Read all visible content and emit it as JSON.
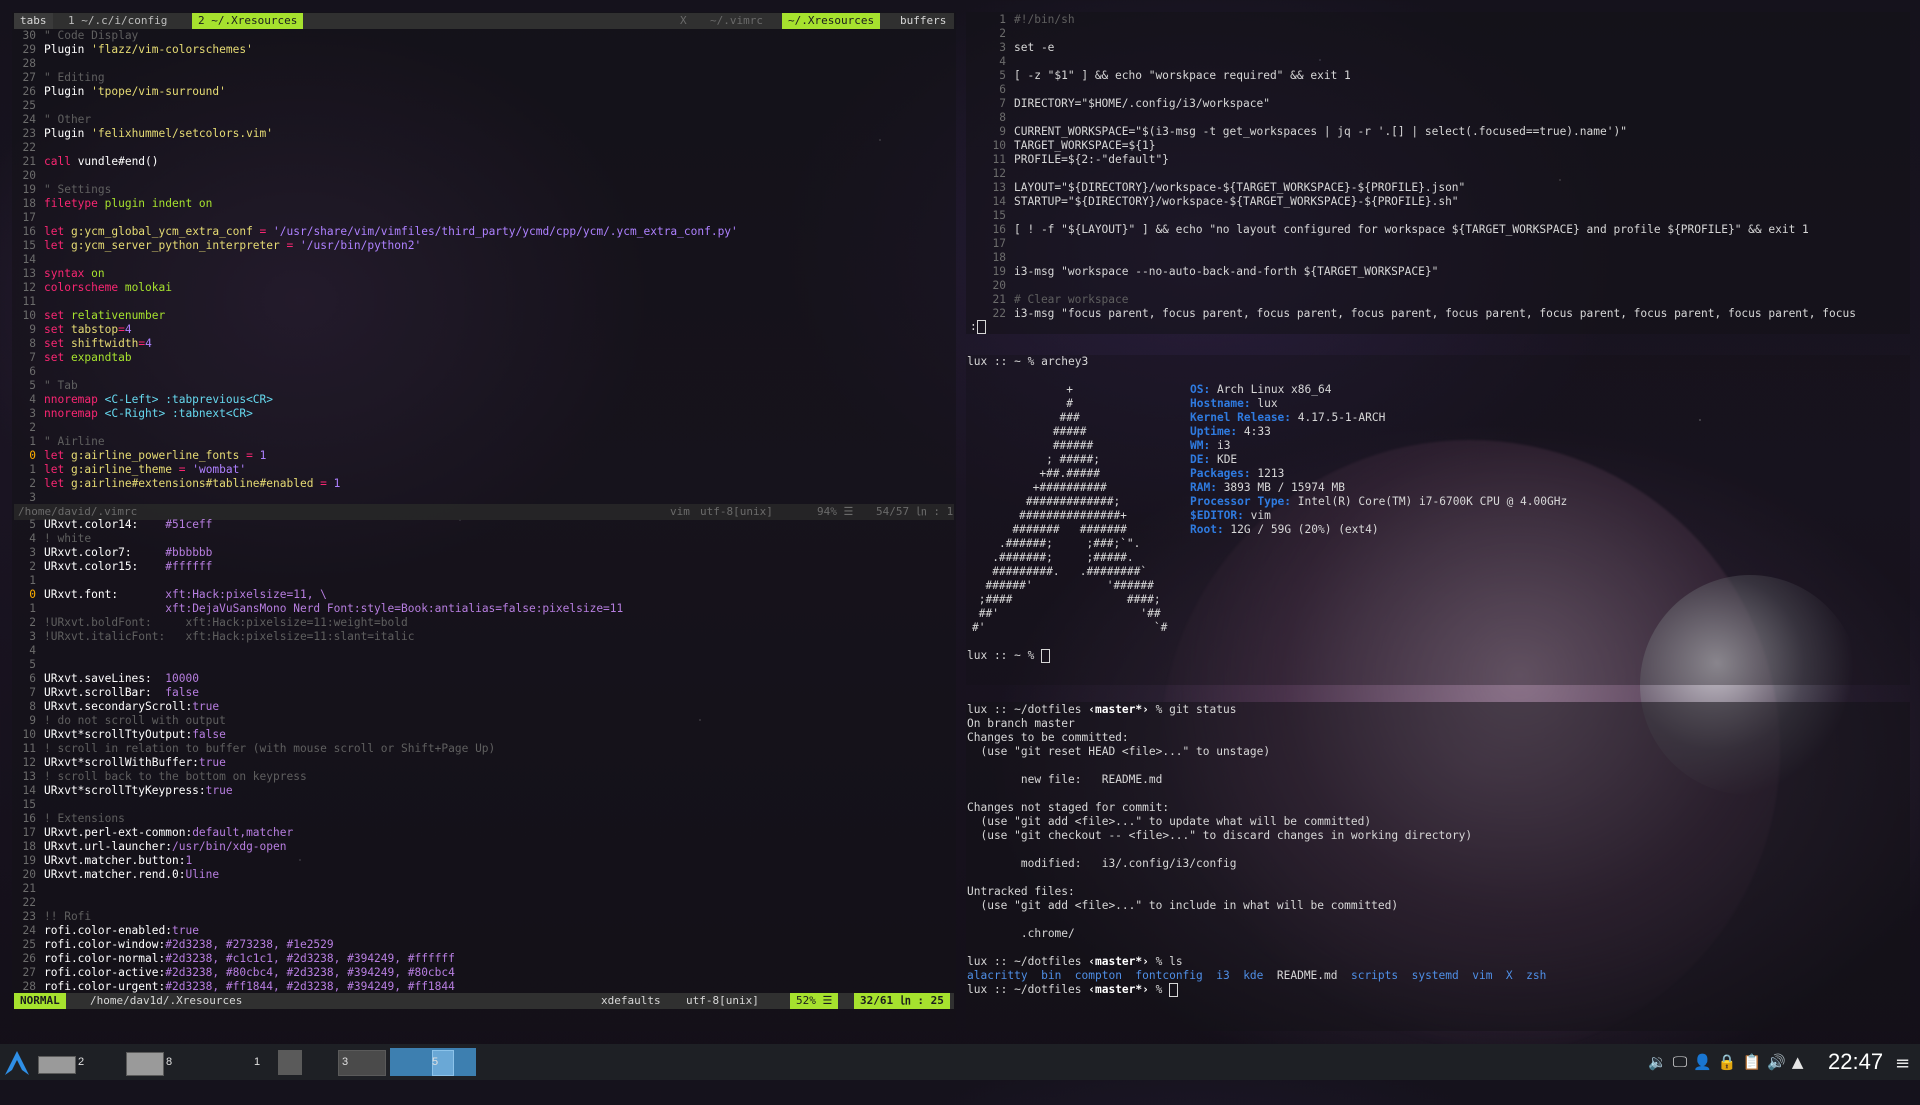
{
  "vim_tabs": {
    "label": "tabs",
    "tab1": "1 ~/.c/i/config",
    "tab2": "2 ~/.Xresources",
    "right_x": "X",
    "right_vimrc": "~/.vimrc",
    "right_xres": "~/.Xresources",
    "buffers": "buffers"
  },
  "vimrc_lines": [
    {
      "n": "30",
      "t": "\" Code Display",
      "c": "cm"
    },
    {
      "n": "29",
      "t": "Plugin 'flazz/vim-colorschemes'",
      "c": "plugin"
    },
    {
      "n": "28",
      "t": "",
      "c": ""
    },
    {
      "n": "27",
      "t": "\" Editing",
      "c": "cm"
    },
    {
      "n": "26",
      "t": "Plugin 'tpope/vim-surround'",
      "c": "plugin"
    },
    {
      "n": "25",
      "t": "",
      "c": ""
    },
    {
      "n": "24",
      "t": "\" Other",
      "c": "cm"
    },
    {
      "n": "23",
      "t": "Plugin 'felixhummel/setcolors.vim'",
      "c": "plugin"
    },
    {
      "n": "22",
      "t": "",
      "c": ""
    },
    {
      "n": "21",
      "t": "call vundle#end()",
      "c": "call"
    },
    {
      "n": "20",
      "t": "",
      "c": ""
    },
    {
      "n": "19",
      "t": "\" Settings",
      "c": "cm"
    },
    {
      "n": "18",
      "t": "filetype plugin indent on",
      "c": "kw"
    },
    {
      "n": "17",
      "t": "",
      "c": ""
    },
    {
      "n": "16",
      "t": "let g:ycm_global_ycm_extra_conf = '/usr/share/vim/vimfiles/third_party/ycmd/cpp/ycm/.ycm_extra_conf.py'",
      "c": "let"
    },
    {
      "n": "15",
      "t": "let g:ycm_server_python_interpreter = '/usr/bin/python2'",
      "c": "let"
    },
    {
      "n": "14",
      "t": "",
      "c": ""
    },
    {
      "n": "13",
      "t": "syntax on",
      "c": "kw"
    },
    {
      "n": "12",
      "t": "colorscheme molokai",
      "c": "kw"
    },
    {
      "n": "11",
      "t": "",
      "c": ""
    },
    {
      "n": "10",
      "t": "set relativenumber",
      "c": "set"
    },
    {
      "n": "9",
      "t": "set tabstop=4",
      "c": "set"
    },
    {
      "n": "8",
      "t": "set shiftwidth=4",
      "c": "set"
    },
    {
      "n": "7",
      "t": "set expandtab",
      "c": "set"
    },
    {
      "n": "6",
      "t": "",
      "c": ""
    },
    {
      "n": "5",
      "t": "\" Tab",
      "c": "cm"
    },
    {
      "n": "4",
      "t": "nnoremap <C-Left> :tabprevious<CR>",
      "c": "map"
    },
    {
      "n": "3",
      "t": "nnoremap <C-Right> :tabnext<CR>",
      "c": "map"
    },
    {
      "n": "2",
      "t": "",
      "c": ""
    },
    {
      "n": "1",
      "t": "\" Airline",
      "c": "cm"
    },
    {
      "n": "0",
      "t": "let g:airline_powerline_fonts = 1",
      "c": "let",
      "cur": true
    },
    {
      "n": "1",
      "t": "let g:airline_theme = 'wombat'",
      "c": "let"
    },
    {
      "n": "2",
      "t": "let g:airline#extensions#tabline#enabled = 1",
      "c": "let"
    },
    {
      "n": "3",
      "t": "",
      "c": ""
    }
  ],
  "vimrc_status": {
    "path": "/home/david/.vimrc",
    "ft": "vim",
    "enc": "utf-8[unix]",
    "pct": "94% ☰",
    "pos": "54/57 ㏑ : 1"
  },
  "xres_lines": [
    {
      "n": "5",
      "k": "URxvt.color14:",
      "v": "#51ceff"
    },
    {
      "n": "4",
      "cm": "! white"
    },
    {
      "n": "3",
      "k": "URxvt.color7:",
      "v": "#bbbbbb"
    },
    {
      "n": "2",
      "k": "URxvt.color15:",
      "v": "#ffffff"
    },
    {
      "n": "1",
      "k": "",
      "v": ""
    },
    {
      "n": "0",
      "k": "URxvt.font:",
      "v": "xft:Hack:pixelsize=11, \\",
      "cur": true
    },
    {
      "n": "1",
      "k": "",
      "v": "xft:DejaVuSansMono Nerd Font:style=Book:antialias=false:pixelsize=11"
    },
    {
      "n": "2",
      "cm": "!URxvt.boldFont:     xft:Hack:pixelsize=11:weight=bold"
    },
    {
      "n": "3",
      "cm": "!URxvt.italicFont:   xft:Hack:pixelsize=11:slant=italic"
    },
    {
      "n": "4",
      "k": "",
      "v": ""
    },
    {
      "n": "5",
      "k": "",
      "v": ""
    },
    {
      "n": "6",
      "k": "URxvt.saveLines:",
      "v": "10000"
    },
    {
      "n": "7",
      "k": "URxvt.scrollBar:",
      "v": "false"
    },
    {
      "n": "8",
      "k": "URxvt.secondaryScroll:",
      "v": "true"
    },
    {
      "n": "9",
      "cm": "! do not scroll with output"
    },
    {
      "n": "10",
      "k": "URxvt*scrollTtyOutput:",
      "v": "false"
    },
    {
      "n": "11",
      "cm": "! scroll in relation to buffer (with mouse scroll or Shift+Page Up)"
    },
    {
      "n": "12",
      "k": "URxvt*scrollWithBuffer:",
      "v": "true"
    },
    {
      "n": "13",
      "cm": "! scroll back to the bottom on keypress"
    },
    {
      "n": "14",
      "k": "URxvt*scrollTtyKeypress:",
      "v": "true"
    },
    {
      "n": "15",
      "k": "",
      "v": ""
    },
    {
      "n": "16",
      "cm": "! Extensions"
    },
    {
      "n": "17",
      "k": "URxvt.perl-ext-common:",
      "v": "default,matcher"
    },
    {
      "n": "18",
      "k": "URxvt.url-launcher:",
      "v": "/usr/bin/xdg-open"
    },
    {
      "n": "19",
      "k": "URxvt.matcher.button:",
      "v": "1"
    },
    {
      "n": "20",
      "k": "URxvt.matcher.rend.0:",
      "v": "Uline"
    },
    {
      "n": "21",
      "k": "",
      "v": ""
    },
    {
      "n": "22",
      "k": "",
      "v": ""
    },
    {
      "n": "23",
      "cm": "!! Rofi"
    },
    {
      "n": "24",
      "k": "rofi.color-enabled:",
      "v": "true"
    },
    {
      "n": "25",
      "k": "rofi.color-window:",
      "v": "#2d3238, #273238, #1e2529"
    },
    {
      "n": "26",
      "k": "rofi.color-normal:",
      "v": "#2d3238, #c1c1c1, #2d3238, #394249, #ffffff"
    },
    {
      "n": "27",
      "k": "rofi.color-active:",
      "v": "#2d3238, #80cbc4, #2d3238, #394249, #80cbc4"
    },
    {
      "n": "28",
      "k": "rofi.color-urgent:",
      "v": "#2d3238, #ff1844, #2d3238, #394249, #ff1844"
    }
  ],
  "xres_status": {
    "mode": "NORMAL",
    "path": "/home/dav1d/.Xresources",
    "ft": "xdefaults",
    "enc": "utf-8[unix]",
    "pct": "52% ☰",
    "pos": "32/61 ㏑ : 25"
  },
  "script_lines": [
    {
      "n": "1",
      "t": "#!/bin/sh",
      "c": "cm"
    },
    {
      "n": "2",
      "t": "",
      "c": ""
    },
    {
      "n": "3",
      "t": "set -e",
      "c": "plain"
    },
    {
      "n": "4",
      "t": "",
      "c": ""
    },
    {
      "n": "5",
      "t": "[ -z \"$1\" ] && echo \"worskpace required\" && exit 1",
      "c": "plain"
    },
    {
      "n": "6",
      "t": "",
      "c": ""
    },
    {
      "n": "7",
      "t": "DIRECTORY=\"$HOME/.config/i3/workspace\"",
      "c": "plain"
    },
    {
      "n": "8",
      "t": "",
      "c": ""
    },
    {
      "n": "9",
      "t": "CURRENT_WORKSPACE=\"$(i3-msg -t get_workspaces | jq -r '.[] | select(.focused==true).name')\"",
      "c": "plain"
    },
    {
      "n": "10",
      "t": "TARGET_WORKSPACE=${1}",
      "c": "plain"
    },
    {
      "n": "11",
      "t": "PROFILE=${2:-\"default\"}",
      "c": "plain"
    },
    {
      "n": "12",
      "t": "",
      "c": ""
    },
    {
      "n": "13",
      "t": "LAYOUT=\"${DIRECTORY}/workspace-${TARGET_WORKSPACE}-${PROFILE}.json\"",
      "c": "plain"
    },
    {
      "n": "14",
      "t": "STARTUP=\"${DIRECTORY}/workspace-${TARGET_WORKSPACE}-${PROFILE}.sh\"",
      "c": "plain"
    },
    {
      "n": "15",
      "t": "",
      "c": ""
    },
    {
      "n": "16",
      "t": "[ ! -f \"${LAYOUT}\" ] && echo \"no layout configured for workspace ${TARGET_WORKSPACE} and profile ${PROFILE}\" && exit 1",
      "c": "plain"
    },
    {
      "n": "17",
      "t": "",
      "c": ""
    },
    {
      "n": "18",
      "t": "",
      "c": ""
    },
    {
      "n": "19",
      "t": "i3-msg \"workspace --no-auto-back-and-forth ${TARGET_WORKSPACE}\"",
      "c": "plain"
    },
    {
      "n": "20",
      "t": "",
      "c": ""
    },
    {
      "n": "21",
      "t": "# Clear workspace",
      "c": "cm"
    },
    {
      "n": "22",
      "t": "i3-msg \"focus parent, focus parent, focus parent, focus parent, focus parent, focus parent, focus parent, focus parent, focus",
      "c": "plain"
    }
  ],
  "script_cmdline": ":",
  "archey": {
    "prompt": "lux :: ~ % archey3",
    "prompt2": "lux :: ~ % ",
    "logo": [
      "              +",
      "              #",
      "             ###",
      "            #####",
      "            ######",
      "           ; #####;",
      "          +##.#####",
      "         +##########",
      "        #############;",
      "       ###############+",
      "      #######   #######",
      "    .######;     ;###;`\".",
      "   .#######;     ;#####.",
      "   #########.   .########`",
      "  ######'           '######",
      " ;####                 ####;",
      " ##'                     '##",
      "#'                         `#"
    ],
    "info": [
      {
        "k": "OS:",
        "v": "Arch Linux x86_64"
      },
      {
        "k": "Hostname:",
        "v": "lux"
      },
      {
        "k": "Kernel Release:",
        "v": "4.17.5-1-ARCH"
      },
      {
        "k": "Uptime:",
        "v": "4:33"
      },
      {
        "k": "WM:",
        "v": "i3"
      },
      {
        "k": "DE:",
        "v": "KDE"
      },
      {
        "k": "Packages:",
        "v": "1213"
      },
      {
        "k": "RAM:",
        "v": "3893 MB",
        "v2": " / 15974 MB"
      },
      {
        "k": "Processor Type:",
        "v": "Intel(R) Core(TM) i7-6700K CPU @ 4.00GHz"
      },
      {
        "k": "$EDITOR:",
        "v": "vim"
      },
      {
        "k": "Root:",
        "v": "12G",
        "v2": " / 59G (20%) (ext4)"
      }
    ]
  },
  "git": {
    "prompt1_pre": "lux :: ~/dotfiles ",
    "prompt1_branch": "‹master*›",
    "prompt1_cmd": " % git status",
    "l1": "On branch master",
    "l2": "Changes to be committed:",
    "l3": "  (use \"git reset HEAD <file>...\" to unstage)",
    "l4_pre": "        new file:   ",
    "l4_file": "README.md",
    "l5": "Changes not staged for commit:",
    "l6": "  (use \"git add <file>...\" to update what will be committed)",
    "l7": "  (use \"git checkout -- <file>...\" to discard changes in working directory)",
    "l8_pre": "        modified:   ",
    "l8_file": "i3/.config/i3/config",
    "l9": "Untracked files:",
    "l10": "  (use \"git add <file>...\" to include in what will be committed)",
    "l11": "        .chrome/",
    "prompt2_cmd": " % ls",
    "ls": [
      "alacritty",
      "bin",
      "compton",
      "fontconfig",
      "i3",
      "kde",
      "README.md",
      "scripts",
      "systemd",
      "vim",
      "X",
      "zsh"
    ],
    "prompt3_cmd": " % "
  },
  "taskbar": {
    "desk1": "2",
    "desk2": "8",
    "desk3": "1",
    "desk4": "3",
    "desk5": "5",
    "clock": "22:47"
  }
}
